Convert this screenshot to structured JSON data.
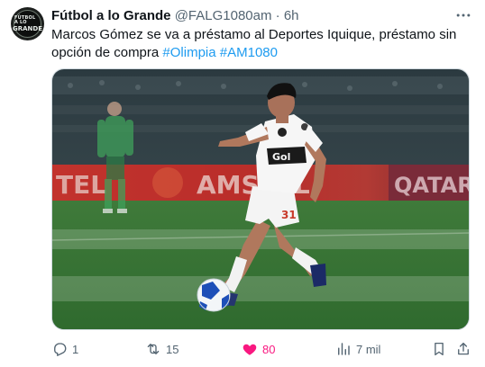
{
  "tweet": {
    "author": {
      "name": "Fútbol a lo Grande",
      "handle": "@FALG1080am",
      "avatar_text_top": "FÚTBOL A LO",
      "avatar_text_bottom": "GRANDE"
    },
    "separator": "·",
    "time": "6h",
    "text": "Marcos Gómez se va a préstamo al Deportes Iquique, préstamo sin opción de compra",
    "hashtags": [
      "#Olimpia",
      "#AM1080"
    ],
    "media": {
      "jersey_number": "31",
      "sponsor_text": "Gol",
      "ad_board_left": "TEL",
      "ad_board_middle": "AMSTEL",
      "ad_board_right": "QATAR"
    },
    "actions": {
      "replies": "1",
      "reposts": "15",
      "likes": "80",
      "views": "7 mil"
    },
    "icons": [
      "more-icon",
      "reply-icon",
      "repost-icon",
      "like-icon",
      "views-icon",
      "bookmark-icon",
      "share-icon"
    ],
    "colors": {
      "link": "#1d9bf0",
      "like": "#f91880",
      "muted": "#536471"
    }
  }
}
